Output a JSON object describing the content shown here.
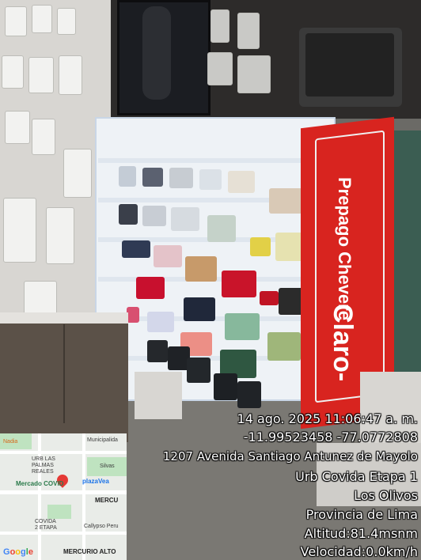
{
  "photo": {
    "display_brand_top": "Prepago Chevere",
    "display_brand_bottom": "Claro-"
  },
  "stamp": {
    "datetime": "14 ago. 2025 11:06:47 a. m.",
    "coordinates": "-11.99523458 -77.0772808",
    "street": "1207 Avenida Santiago Antunez de Mayolo",
    "neighborhood": "Urb Covida Etapa 1",
    "district": "Los Olivos",
    "province": "Provincia de Lima",
    "altitude": "Altitud:81.4msnm",
    "speed": "Velocidad:0.0km/h"
  },
  "map": {
    "labels": {
      "nadia": "Nadia",
      "municipalidad": "Municipalida",
      "urb_palmas": "URB LAS PALMAS REALES",
      "silvas": "Silvas",
      "mercado": "Mercado COVID",
      "plazavea": "plazaVea",
      "mercu": "MERCU",
      "covida2": "COVIDA 2 ETAPA",
      "callypso": "Callypso Peru",
      "mercurio": "MERCURIO ALTO"
    },
    "logo": "Google"
  }
}
